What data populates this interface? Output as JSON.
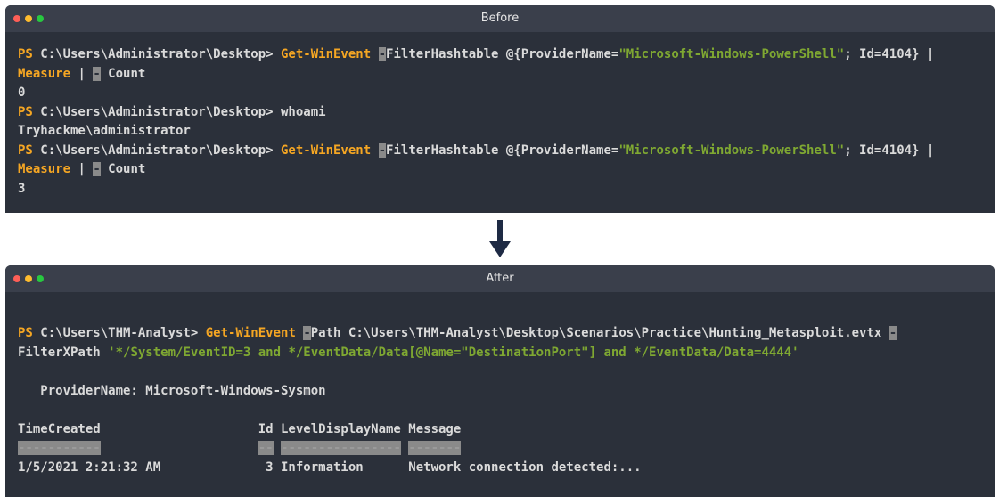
{
  "before": {
    "title": "Before",
    "line1": {
      "ps": "PS",
      "path": " C:\\Users\\Administrator\\Desktop>",
      "cmd": " Get-WinEvent",
      "sp": " ",
      "sel": "-",
      "arg": "FilterHashtable @{ProviderName=",
      "str": "\"Microsoft-Windows-PowerShell\"",
      "rest": "; Id=4104} |"
    },
    "line2": {
      "cmd": "Measure",
      "pipe": " | ",
      "sel": "-",
      "rest": " Count"
    },
    "line3": "0",
    "line4": {
      "ps": "PS",
      "path": " C:\\Users\\Administrator\\Desktop>",
      "rest": " whoami"
    },
    "line5": "Tryhackme\\administrator",
    "line6": {
      "ps": "PS",
      "path": " C:\\Users\\Administrator\\Desktop>",
      "cmd": " Get-WinEvent",
      "sp": " ",
      "sel": "-",
      "arg": "FilterHashtable @{ProviderName=",
      "str": "\"Microsoft-Windows-PowerShell\"",
      "rest": "; Id=4104} |"
    },
    "line7": {
      "cmd": "Measure",
      "pipe": " | ",
      "sel": "-",
      "rest": " Count"
    },
    "line8": "3"
  },
  "after": {
    "title": "After",
    "line1": {
      "ps": "PS",
      "path": " C:\\Users\\THM-Analyst>",
      "cmd": " Get-WinEvent",
      "sp": " ",
      "sel": "-",
      "arg": "Path C:\\Users\\THM-Analyst\\Desktop\\Scenarios\\Practice\\Hunting_Metasploit.evtx ",
      "sel2": "-"
    },
    "line2": {
      "arg": "FilterXPath ",
      "str": "'*/System/EventID=3 and */EventData/Data[@Name=\"DestinationPort\"] and */EventData/Data=4444'"
    },
    "provider": "   ProviderName: Microsoft-Windows-Sysmon",
    "header": "TimeCreated                     Id LevelDisplayName Message",
    "dashes": {
      "a": "-----------",
      "b": "--",
      "c": "----------------",
      "d": "-------"
    },
    "row": "1/5/2021 2:21:32 AM              3 Information      Network connection detected:..."
  },
  "colors": {
    "terminal_bg": "#2b303a",
    "titlebar": "#3a3f4b",
    "prompt": "#f5a623",
    "string": "#7fa832",
    "arrow": "#1e2a44"
  },
  "icons": {
    "arrow": "arrow-down-icon"
  }
}
